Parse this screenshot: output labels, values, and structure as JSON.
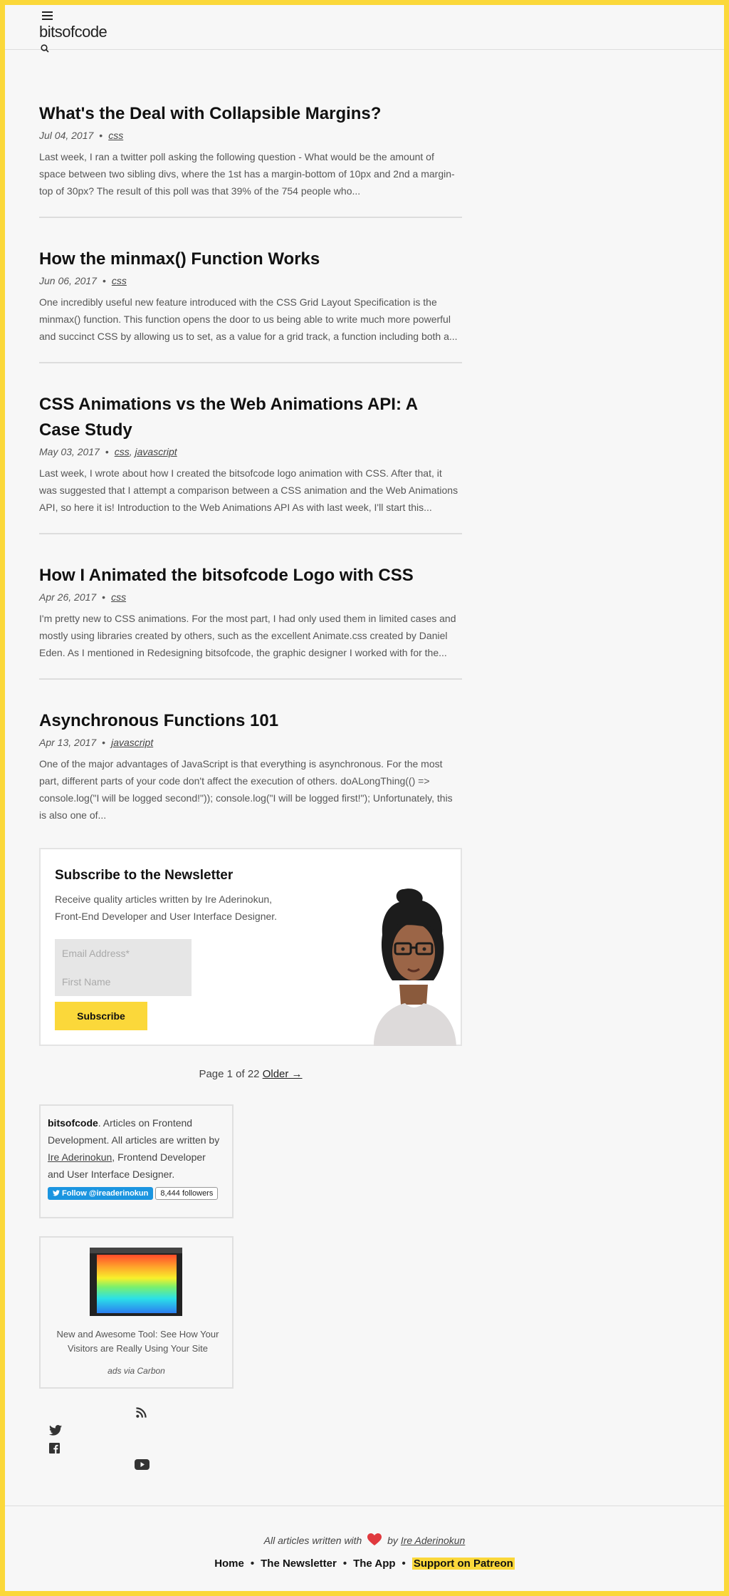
{
  "site": {
    "logo": "bitsofcode"
  },
  "posts": [
    {
      "title": "What's the Deal with Collapsible Margins?",
      "date": "Jul 04, 2017",
      "tags": [
        "css"
      ],
      "excerpt": "Last week, I ran a twitter poll asking the following question - What would be the amount of space between two sibling divs, where the 1st has a margin-bottom of 10px and 2nd a margin-top of 30px? The result of this poll was that 39% of the 754 people who..."
    },
    {
      "title": "How the minmax() Function Works",
      "date": "Jun 06, 2017",
      "tags": [
        "css"
      ],
      "excerpt": "One incredibly useful new feature introduced with the CSS Grid Layout Specification is the minmax() function. This function opens the door to us being able to write much more powerful and succinct CSS by allowing us to set, as a value for a grid track, a function including both a..."
    },
    {
      "title": "CSS Animations vs the Web Animations API: A Case Study",
      "date": "May 03, 2017",
      "tags": [
        "css",
        "javascript"
      ],
      "excerpt": "Last week, I wrote about how I created the bitsofcode logo animation with CSS. After that, it was suggested that I attempt a comparison between a CSS animation and the Web Animations API, so here it is! Introduction to the Web Animations API As with last week, I'll start this..."
    },
    {
      "title": "How I Animated the bitsofcode Logo with CSS",
      "date": "Apr 26, 2017",
      "tags": [
        "css"
      ],
      "excerpt": "I'm pretty new to CSS animations. For the most part, I had only used them in limited cases and mostly using libraries created by others, such as the excellent Animate.css created by Daniel Eden. As I mentioned in Redesigning bitsofcode, the graphic designer I worked with for the..."
    },
    {
      "title": "Asynchronous Functions 101",
      "date": "Apr 13, 2017",
      "tags": [
        "javascript"
      ],
      "excerpt": "One of the major advantages of JavaScript is that everything is asynchronous. For the most part, different parts of your code don't affect the execution of others. doALongThing(() => console.log(\"I will be logged second!\")); console.log(\"I will be logged first!\"); Unfortunately, this is also one of..."
    }
  ],
  "newsletter": {
    "title": "Subscribe to the Newsletter",
    "description": "Receive quality articles written by Ire Aderinokun, Front-End Developer and User Interface Designer.",
    "email_placeholder": "Email Address*",
    "name_placeholder": "First Name",
    "button_label": "Subscribe"
  },
  "pagination": {
    "label": "Page 1 of 22",
    "older_label": "Older →"
  },
  "about": {
    "name": "bitsofcode",
    "text_1": ". Articles on Frontend Development. All articles are written by ",
    "author": "Ire Aderinokun",
    "text_2": ", Frontend Developer and User Interface Designer.",
    "follow_label": "Follow @ireaderinokun",
    "followers": "8,444 followers"
  },
  "ad": {
    "text": "New and Awesome Tool: See How Your Visitors are Really Using Your Site",
    "via": "ads via Carbon"
  },
  "social_icons": [
    "rss-icon",
    "twitter-icon",
    "facebook-icon",
    "youtube-icon"
  ],
  "footer": {
    "credit_prefix": "All articles written with",
    "credit_by": "by",
    "credit_author": "Ire Aderinokun",
    "nav": [
      "Home",
      "The Newsletter",
      "The App",
      "Support on Patreon"
    ]
  },
  "colors": {
    "accent": "#fbd83a",
    "twitter": "#1b95e0",
    "heart": "#e0393e"
  }
}
